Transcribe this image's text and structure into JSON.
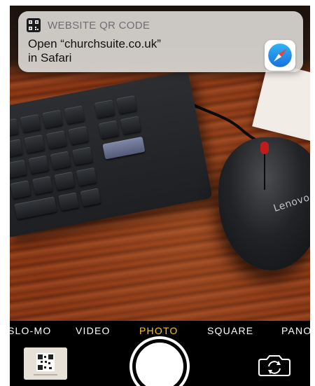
{
  "notification": {
    "title": "WEBSITE QR CODE",
    "message_line1": "Open “churchsuite.co.uk”",
    "message_line2": "in Safari",
    "app_icon": "safari-icon",
    "type_icon": "qr-code-icon"
  },
  "viewfinder": {
    "mouse_brand": "Lenovo"
  },
  "camera_modes": {
    "slo_mo": "SLO-MO",
    "video": "VIDEO",
    "photo": "PHOTO",
    "square": "SQUARE",
    "pano": "PANO",
    "active": "PHOTO",
    "active_color": "#f5c518"
  },
  "controls": {
    "thumbnail_icon": "last-photo-thumbnail",
    "shutter_icon": "shutter-icon",
    "flip_icon": "flip-camera-icon"
  }
}
